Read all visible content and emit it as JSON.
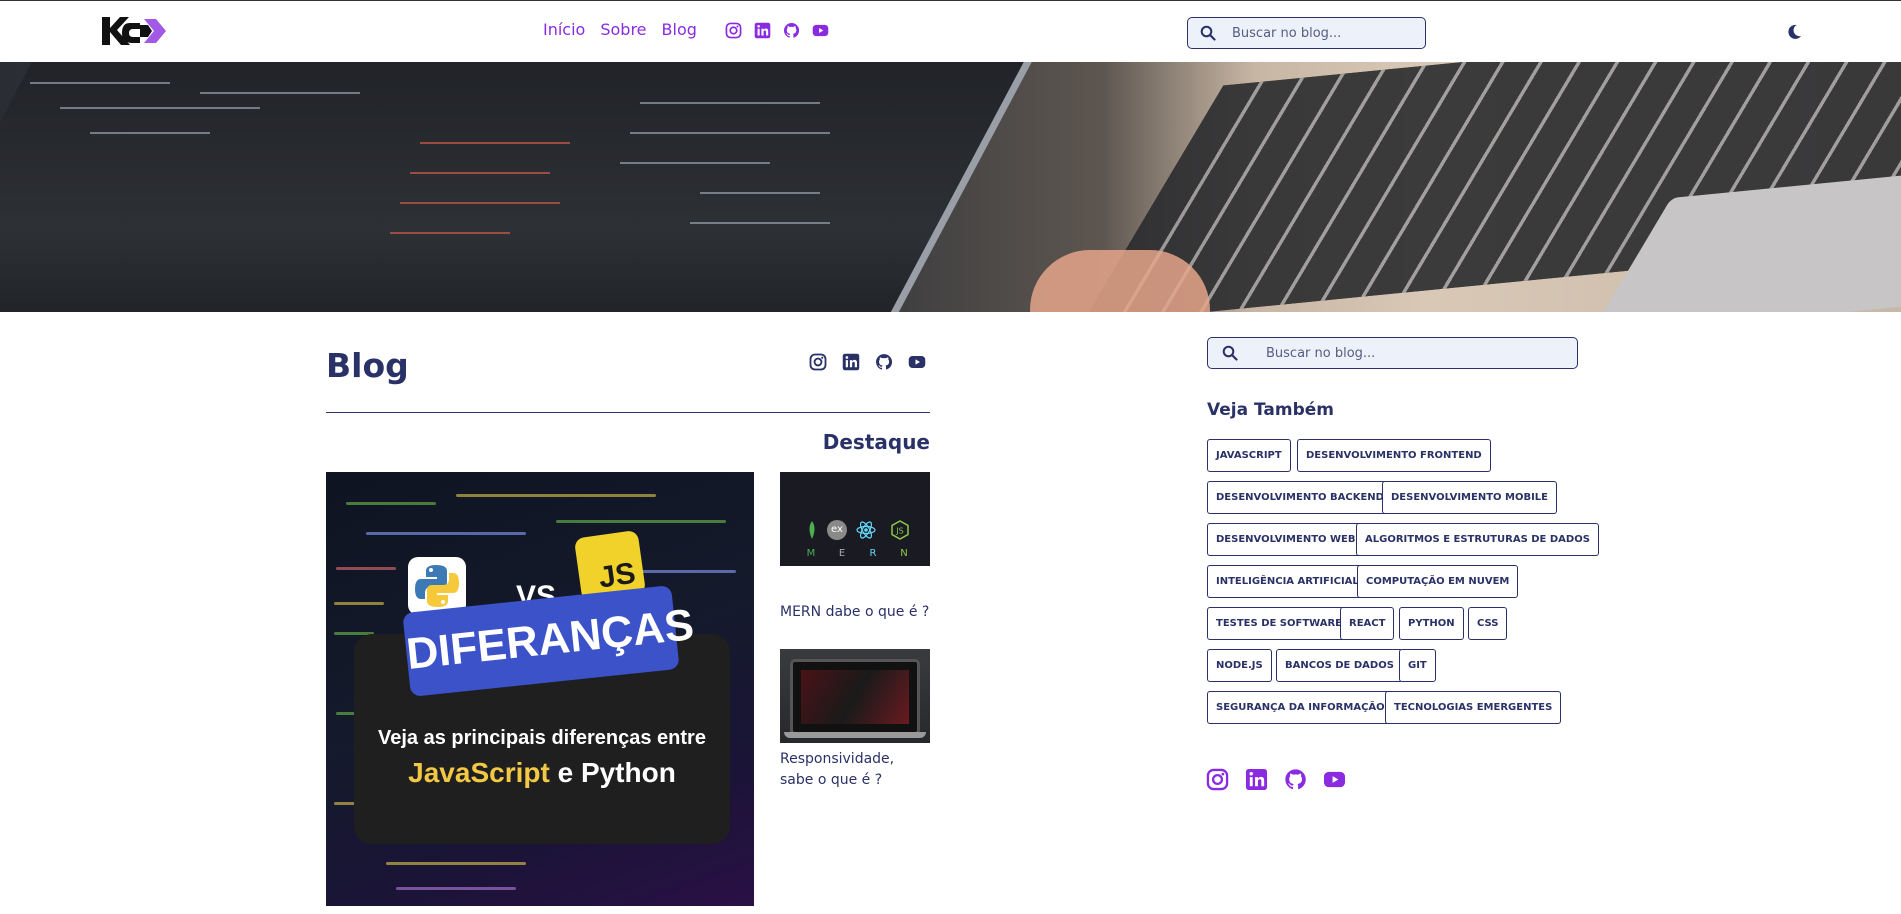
{
  "header": {
    "nav": [
      "Início",
      "Sobre",
      "Blog"
    ],
    "social_icons": [
      "instagram-icon",
      "linkedin-icon",
      "github-icon",
      "youtube-icon"
    ],
    "search_placeholder": "Buscar no blog...",
    "theme_toggle_icon": "moon-icon"
  },
  "main": {
    "title": "Blog",
    "social_icons": [
      "instagram-icon",
      "linkedin-icon",
      "github-icon",
      "youtube-icon"
    ],
    "section_title": "Destaque",
    "featured": {
      "vs": "VS",
      "js_badge": "JS",
      "headline": "DIFERANÇAS",
      "sub": "Veja as principais diferenças entre",
      "lang1": "JavaScript",
      "conj": " e ",
      "lang2": "Python"
    },
    "posts": [
      {
        "caption": "MERN dabe o que é ?",
        "letters": [
          "M",
          "E",
          "R",
          "N"
        ],
        "ex": "ex"
      },
      {
        "caption": "Responsividade, sabe o que é ?"
      }
    ]
  },
  "sidebar": {
    "search_placeholder": "Buscar no blog...",
    "see_also": "Veja Também",
    "tags": [
      "JAVASCRIPT",
      "DESENVOLVIMENTO FRONTEND",
      "DESENVOLVIMENTO BACKEND",
      "DESENVOLVIMENTO MOBILE",
      "DESENVOLVIMENTO WEB",
      "ALGORITMOS E ESTRUTURAS DE DADOS",
      "INTELIGÊNCIA ARTIFICIAL",
      "COMPUTAÇÃO EM NUVEM",
      "TESTES DE SOFTWARE",
      "REACT",
      "PYTHON",
      "CSS",
      "NODE.JS",
      "BANCOS DE DADOS",
      "GIT",
      "SEGURANÇA DA INFORMAÇÃO",
      "TECNOLOGIAS EMERGENTES"
    ],
    "social_icons": [
      "instagram-icon",
      "linkedin-icon",
      "github-icon",
      "youtube-icon"
    ]
  },
  "colors": {
    "navy": "#2a3166",
    "purple": "#8a2be2",
    "search_bg": "#edf1f9"
  }
}
